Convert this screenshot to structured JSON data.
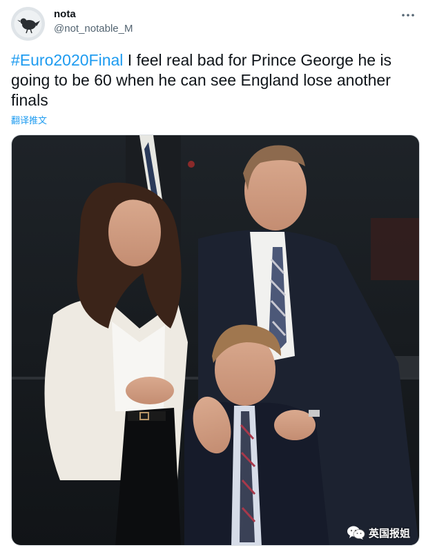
{
  "tweet": {
    "author": {
      "display_name": "nota",
      "handle": "@not_notable_M",
      "avatar_icon": "bird-avatar-icon"
    },
    "text": {
      "hashtag": "#Euro2020Final",
      "body": " I feel real bad for Prince George he is going to be 60 when he can see England lose another finals"
    },
    "translate_label": "翻译推文",
    "more_icon": "more-options-icon"
  },
  "watermark": {
    "text": "英国报姐",
    "icon": "wechat-icon"
  },
  "colors": {
    "link": "#1d9bf0",
    "text": "#0f1419",
    "secondary": "#536471"
  }
}
